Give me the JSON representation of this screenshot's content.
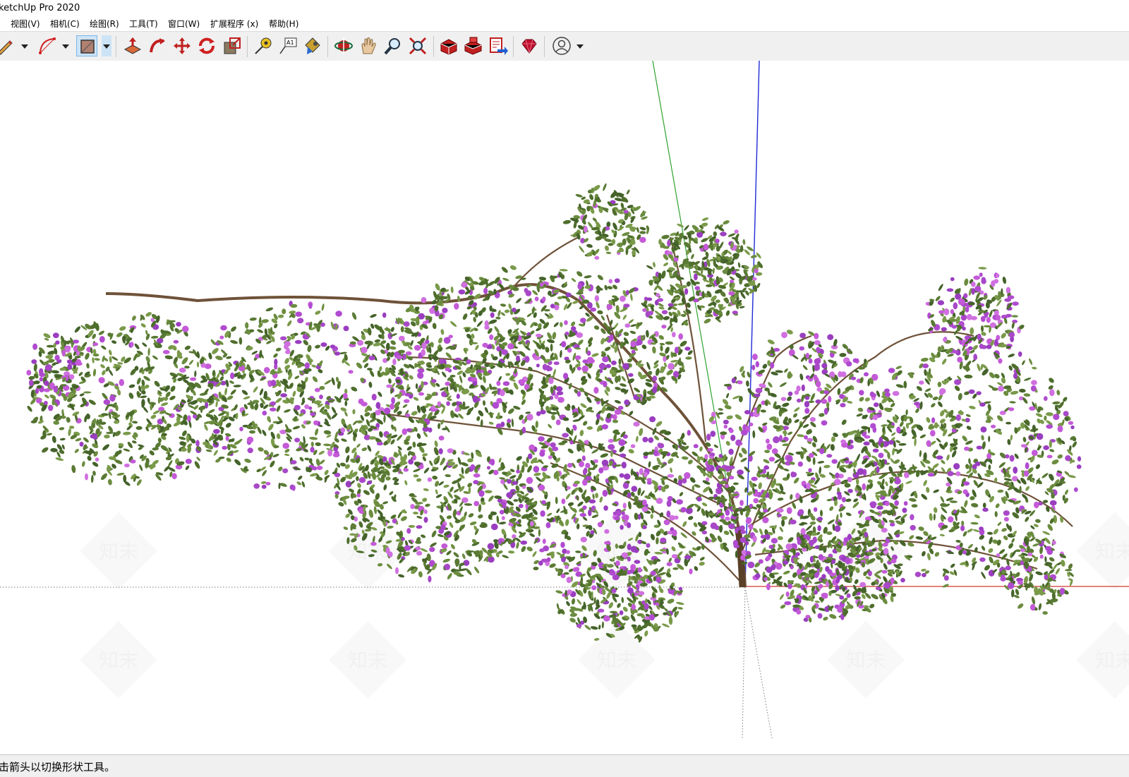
{
  "window": {
    "title": "ketchUp Pro 2020"
  },
  "menu": [
    {
      "label": "视图(V)"
    },
    {
      "label": "相机(C)"
    },
    {
      "label": "绘图(R)"
    },
    {
      "label": "工具(T)"
    },
    {
      "label": "窗口(W)"
    },
    {
      "label": "扩展程序 (x)"
    },
    {
      "label": "帮助(H)"
    }
  ],
  "toolbar": {
    "tools": [
      {
        "icon": "pencil-line-icon"
      },
      {
        "icon": "arc-icon"
      },
      {
        "icon": "rectangle-shape-icon",
        "active": true
      },
      {
        "icon": "push-pull-icon"
      },
      {
        "icon": "follow-me-icon"
      },
      {
        "icon": "move-icon"
      },
      {
        "icon": "rotate-icon"
      },
      {
        "icon": "scale-icon"
      },
      {
        "icon": "tape-measure-icon"
      },
      {
        "icon": "text-tool-icon"
      },
      {
        "icon": "paint-bucket-icon"
      },
      {
        "icon": "orbit-icon"
      },
      {
        "icon": "pan-icon"
      },
      {
        "icon": "zoom-icon"
      },
      {
        "icon": "zoom-extents-icon"
      },
      {
        "icon": "3d-warehouse-icon"
      },
      {
        "icon": "extension-warehouse-icon"
      },
      {
        "icon": "layout-send-icon"
      },
      {
        "icon": "ruby-console-icon"
      },
      {
        "icon": "account-icon"
      }
    ]
  },
  "status": {
    "text": "击箭头以切换形状工具。"
  },
  "watermark": {
    "text": "知末"
  },
  "colors": {
    "axis_red": "#d2342e",
    "axis_green": "#2fa32f",
    "axis_blue": "#1f2bd6",
    "leaf": "#5a7a34",
    "blossom": "#b04bd0",
    "trunk": "#6e5238"
  }
}
